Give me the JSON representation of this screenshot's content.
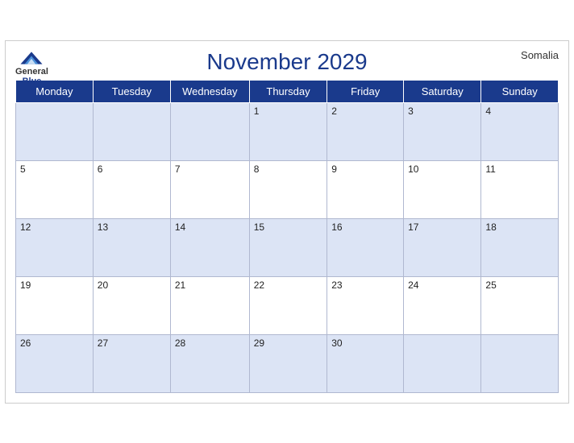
{
  "header": {
    "title": "November 2029",
    "country": "Somalia",
    "logo_general": "General",
    "logo_blue": "Blue"
  },
  "weekdays": [
    "Monday",
    "Tuesday",
    "Wednesday",
    "Thursday",
    "Friday",
    "Saturday",
    "Sunday"
  ],
  "weeks": [
    [
      null,
      null,
      null,
      1,
      2,
      3,
      4
    ],
    [
      5,
      6,
      7,
      8,
      9,
      10,
      11
    ],
    [
      12,
      13,
      14,
      15,
      16,
      17,
      18
    ],
    [
      19,
      20,
      21,
      22,
      23,
      24,
      25
    ],
    [
      26,
      27,
      28,
      29,
      30,
      null,
      null
    ]
  ]
}
